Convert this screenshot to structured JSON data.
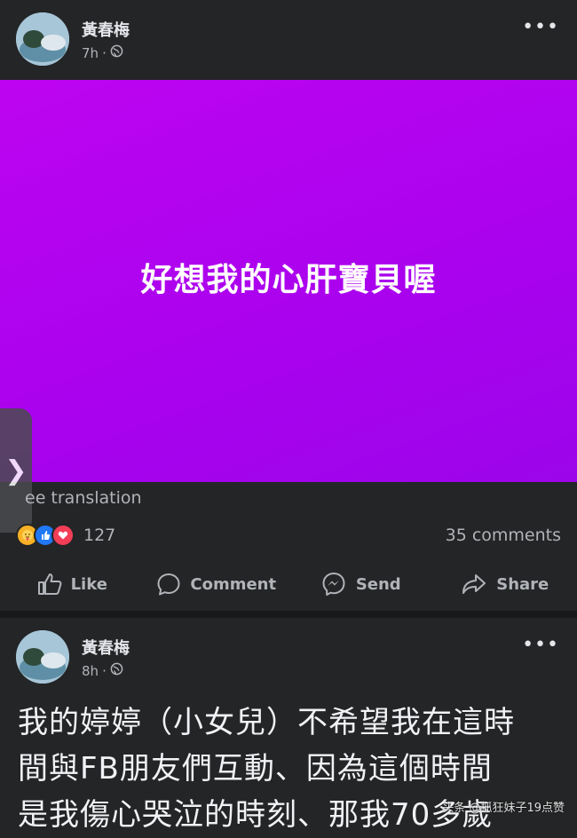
{
  "post1": {
    "author": "黃春梅",
    "time": "7h",
    "separator": "·",
    "privacy_icon": "globe-icon",
    "more_icon": "more-dots-icon",
    "banner_text": "好想我的心肝寶貝喔",
    "banner_color": "#b005f0",
    "see_translation": "ee translation",
    "reaction_icons": [
      "care-reaction-icon",
      "like-reaction-icon",
      "love-reaction-icon"
    ],
    "reaction_count": "127",
    "comments_count": "35 comments",
    "actions": [
      {
        "label": "Like",
        "icon": "thumbs-up-icon"
      },
      {
        "label": "Comment",
        "icon": "comment-bubble-icon"
      },
      {
        "label": "Send",
        "icon": "messenger-icon"
      },
      {
        "label": "Share",
        "icon": "share-arrow-icon"
      }
    ]
  },
  "post2": {
    "author": "黃春梅",
    "time": "8h",
    "separator": "·",
    "text_lines": [
      "我的婷婷（小女兒）不希望我在這時",
      "間與FB朋友們互動、因為這個時間",
      "是我傷心哭泣的時刻、那我70多歲"
    ]
  },
  "side_handle_glyph": "❯",
  "more_glyph": "•••",
  "watermark": "头条 @抓狂妹子19点赞"
}
